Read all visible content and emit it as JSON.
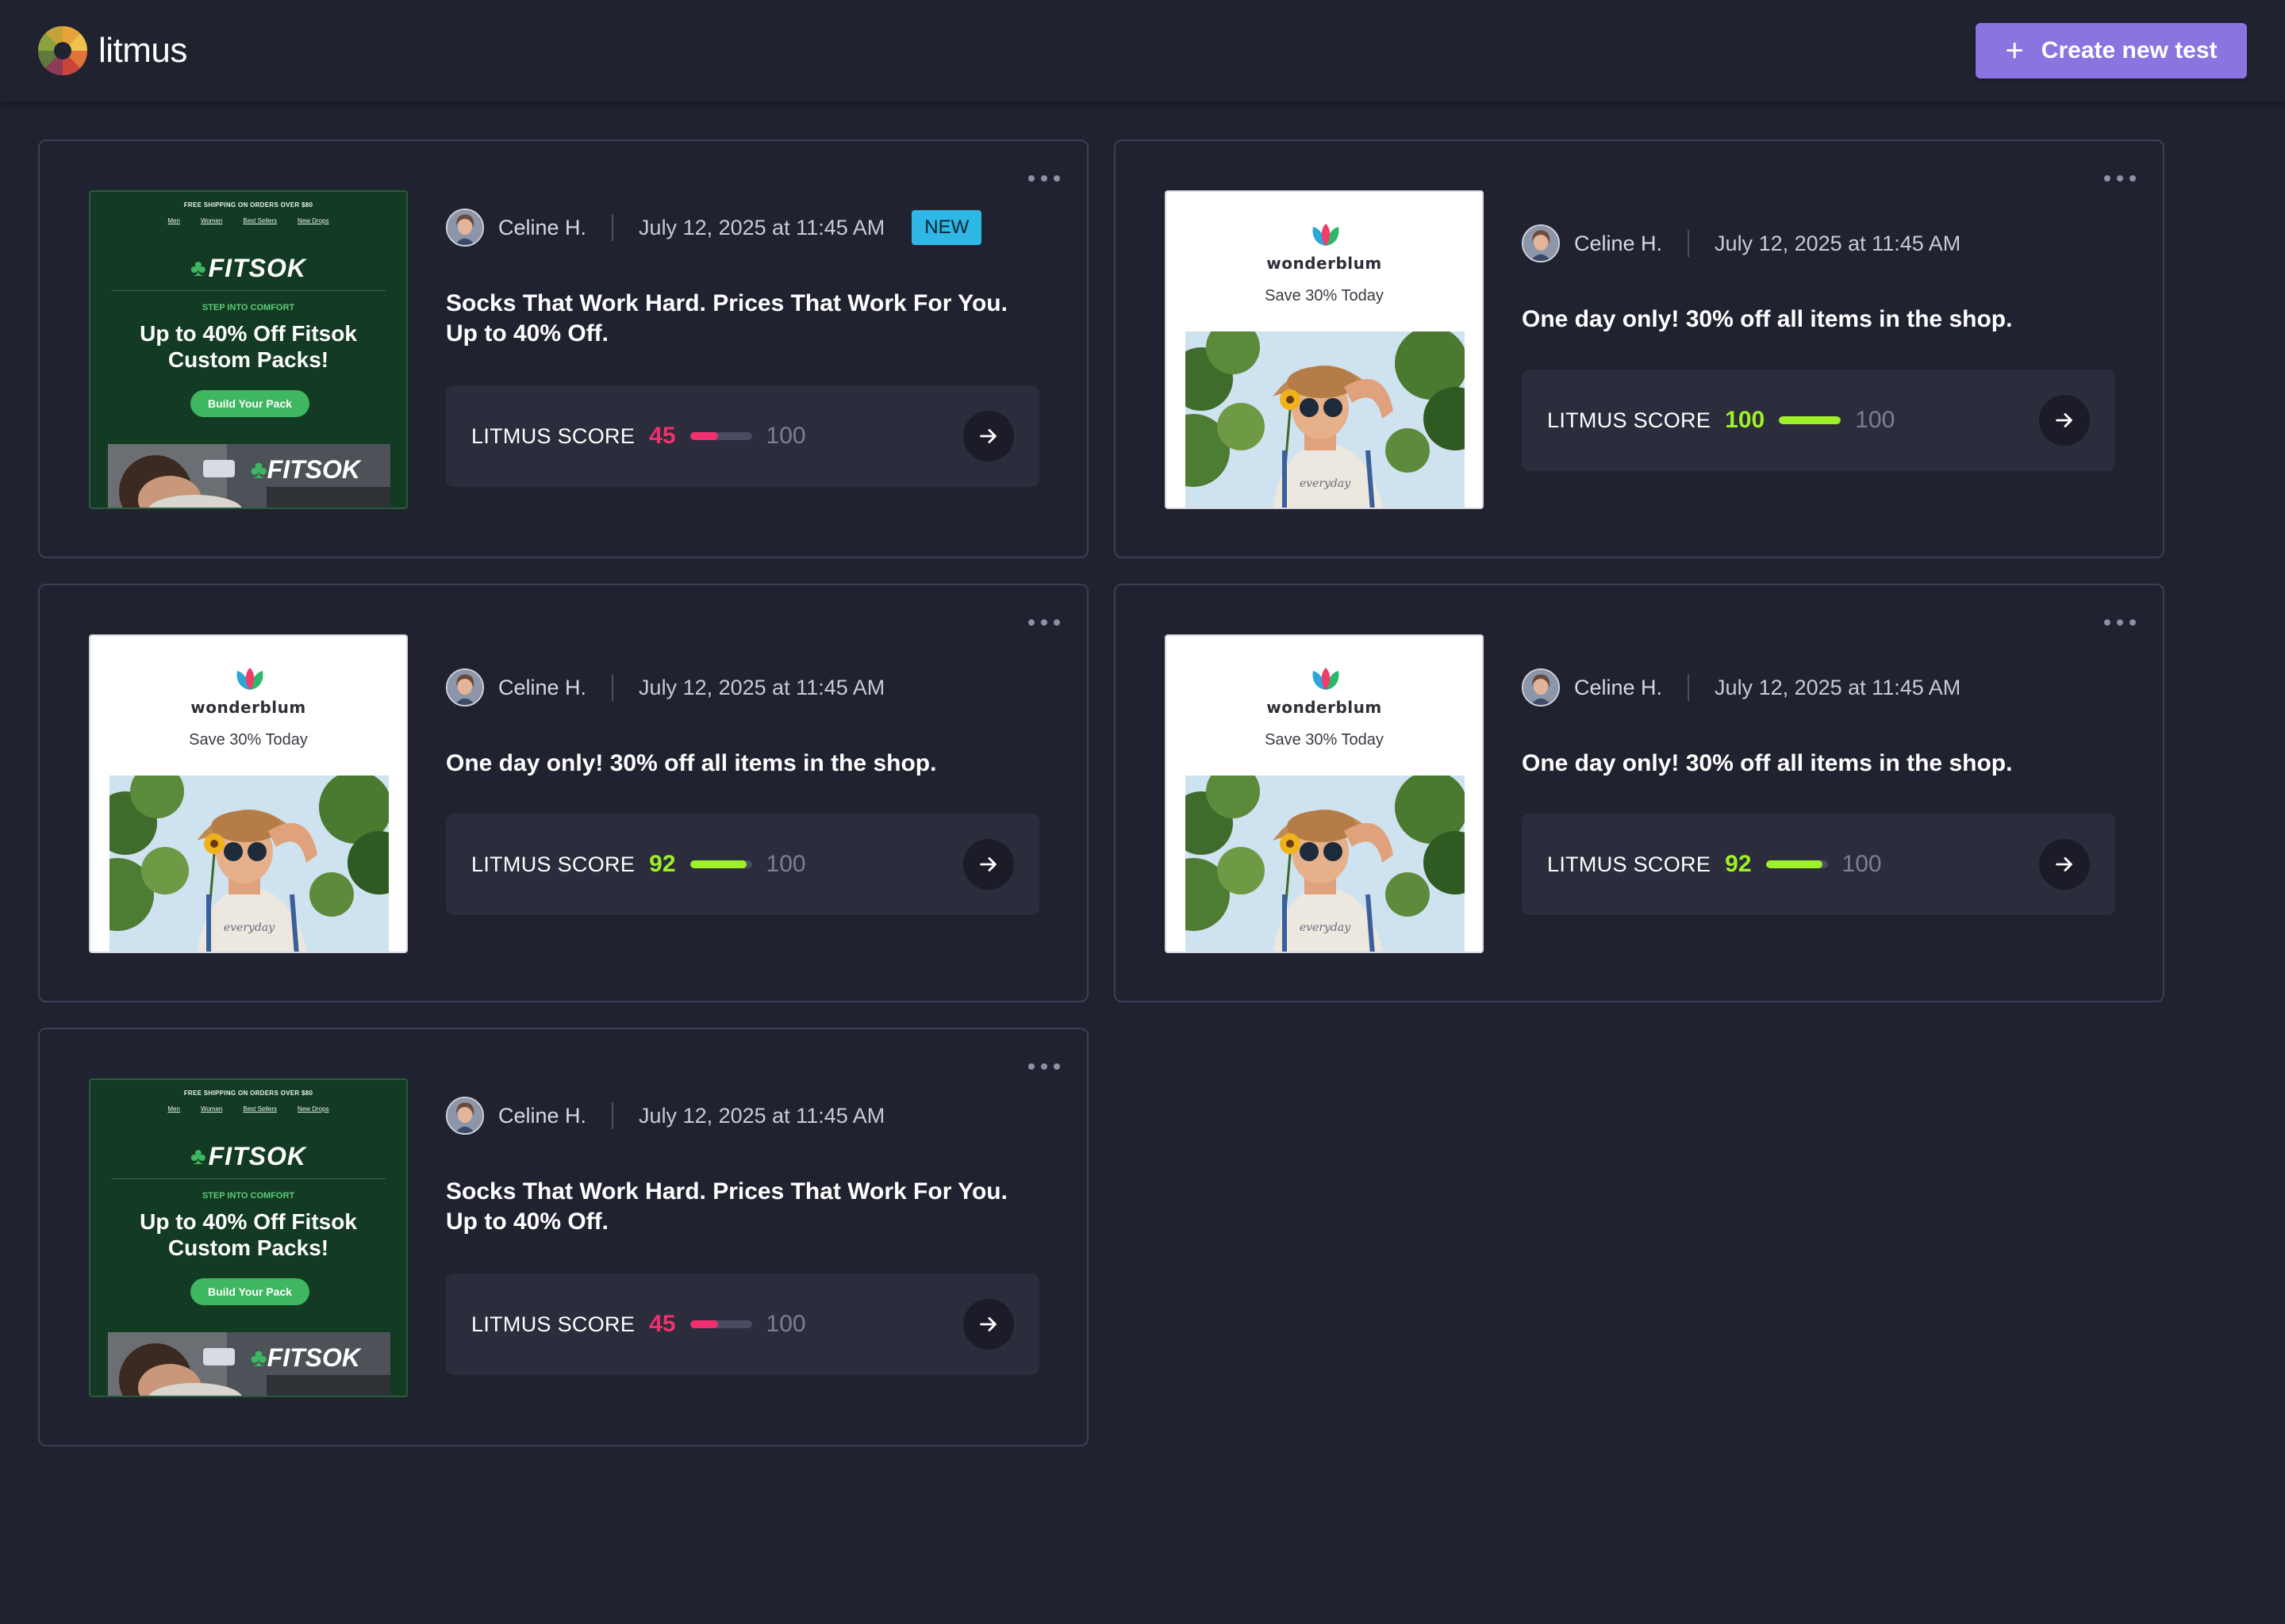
{
  "app": {
    "brand_name": "litmus",
    "create_button_label": "Create new test",
    "create_button_icon": "plus-icon",
    "colors": {
      "background": "#202230",
      "accent": "#8a74e0",
      "score_low": "#f0306e",
      "score_high": "#9ef028",
      "new_badge": "#2fb7e6"
    }
  },
  "cards": [
    {
      "template": "fitsok",
      "author": "Celine H.",
      "date": "July 12, 2025 at 11:45 AM",
      "badge": "NEW",
      "subject_lines": [
        "Socks That Work Hard. Prices That Work For You.",
        "Up to 40% Off."
      ],
      "score_label": "LITMUS SCORE",
      "score": 45,
      "score_max": 100,
      "score_color": "#f0306e",
      "preview": {
        "shipping": "FREE SHIPPING ON ORDERS OVER $80",
        "nav": [
          "Men",
          "Women",
          "Best Sellers",
          "New Drops"
        ],
        "logo": "FITSOK",
        "kicker": "STEP INTO COMFORT",
        "headline": "Up to 40% Off Fitsok Custom Packs!",
        "cta": "Build Your Pack",
        "photo_logo": "FITSOK"
      }
    },
    {
      "template": "wonderblum",
      "author": "Celine H.",
      "date": "July 12, 2025 at 11:45 AM",
      "subject_lines": [
        "One day only! 30% off all items in the shop."
      ],
      "score_label": "LITMUS SCORE",
      "score": 100,
      "score_max": 100,
      "score_color": "#9ef028",
      "preview": {
        "brand": "wonderblum",
        "tagline": "Save 30% Today"
      }
    },
    {
      "template": "wonderblum",
      "author": "Celine H.",
      "date": "July 12, 2025 at 11:45 AM",
      "subject_lines": [
        "One day only! 30% off all items in the shop."
      ],
      "score_label": "LITMUS SCORE",
      "score": 92,
      "score_max": 100,
      "score_color": "#9ef028",
      "preview": {
        "brand": "wonderblum",
        "tagline": "Save 30% Today"
      }
    },
    {
      "template": "wonderblum",
      "author": "Celine H.",
      "date": "July 12, 2025 at 11:45 AM",
      "subject_lines": [
        "One day only! 30% off all items in the shop."
      ],
      "score_label": "LITMUS SCORE",
      "score": 92,
      "score_max": 100,
      "score_color": "#9ef028",
      "preview": {
        "brand": "wonderblum",
        "tagline": "Save 30% Today"
      }
    },
    {
      "template": "fitsok",
      "author": "Celine H.",
      "date": "July 12, 2025 at 11:45 AM",
      "subject_lines": [
        "Socks That Work Hard. Prices That Work For You.",
        "Up to 40% Off."
      ],
      "score_label": "LITMUS SCORE",
      "score": 45,
      "score_max": 100,
      "score_color": "#f0306e",
      "preview": {
        "shipping": "FREE SHIPPING ON ORDERS OVER $80",
        "nav": [
          "Men",
          "Women",
          "Best Sellers",
          "New Drops"
        ],
        "logo": "FITSOK",
        "kicker": "STEP INTO COMFORT",
        "headline": "Up to 40% Off Fitsok Custom Packs!",
        "cta": "Build Your Pack",
        "photo_logo": "FITSOK"
      }
    }
  ]
}
